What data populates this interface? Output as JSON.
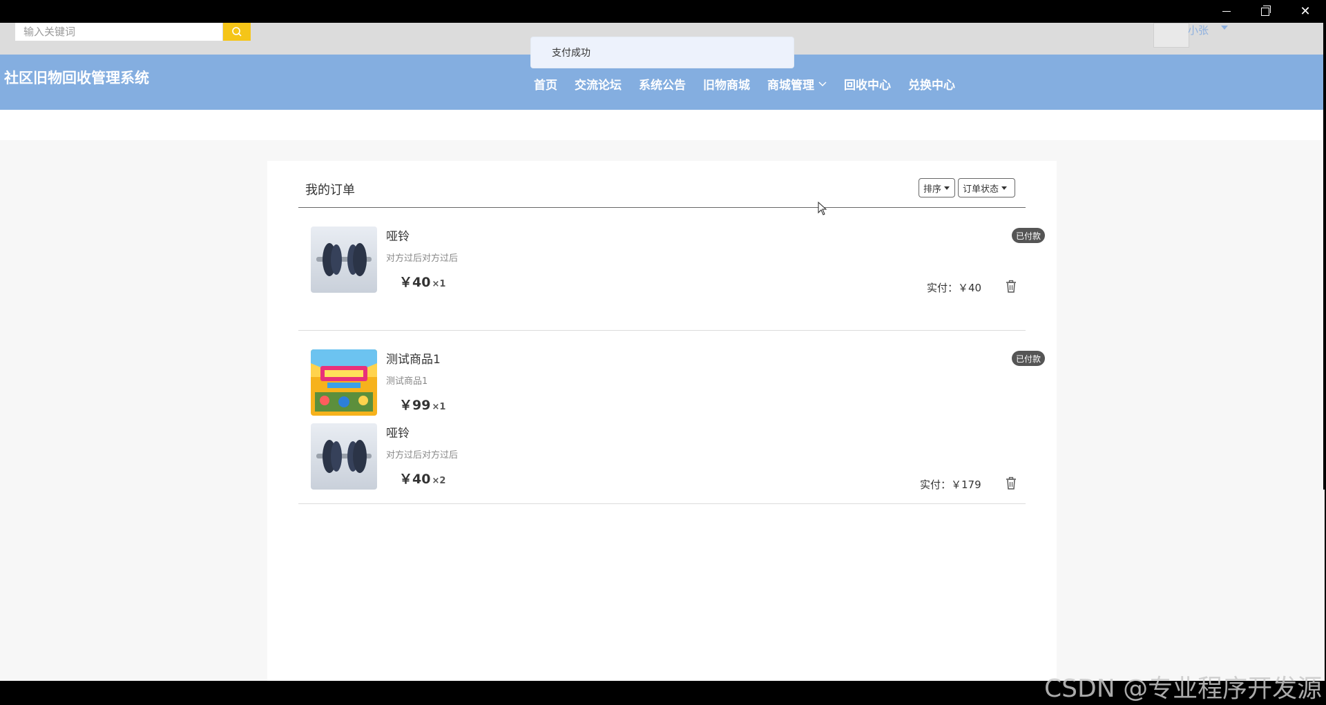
{
  "search": {
    "placeholder": "输入关键词"
  },
  "user": {
    "name": "小张"
  },
  "site": {
    "title": "社区旧物回收管理系统"
  },
  "nav": {
    "items": [
      {
        "label": "首页"
      },
      {
        "label": "交流论坛"
      },
      {
        "label": "系统公告"
      },
      {
        "label": "旧物商城"
      },
      {
        "label": "商城管理",
        "has_dropdown": true
      },
      {
        "label": "回收中心"
      },
      {
        "label": "兑换中心"
      }
    ]
  },
  "toast": {
    "message": "支付成功"
  },
  "orders_page": {
    "title": "我的订单",
    "sort_label": "排序",
    "status_filter_label": "订单状态"
  },
  "orders": [
    {
      "status": "已付款",
      "total": "实付：￥40",
      "items": [
        {
          "name": "哑铃",
          "desc": "对方过后对方过后",
          "price": "￥40",
          "qty": "×1",
          "image": "dumbbell"
        }
      ]
    },
    {
      "status": "已付款",
      "total": "实付：￥179",
      "items": [
        {
          "name": "测试商品1",
          "desc": "测试商品1",
          "price": "￥99",
          "qty": "×1",
          "image": "promo-poster"
        },
        {
          "name": "哑铃",
          "desc": "对方过后对方过后",
          "price": "￥40",
          "qty": "×2",
          "image": "dumbbell"
        }
      ]
    }
  ],
  "watermark": {
    "text": "CSDN @专业程序开发源"
  },
  "colors": {
    "nav_bg": "#84aee0",
    "search_btn": "#f5c518",
    "badge_bg": "#555555"
  }
}
